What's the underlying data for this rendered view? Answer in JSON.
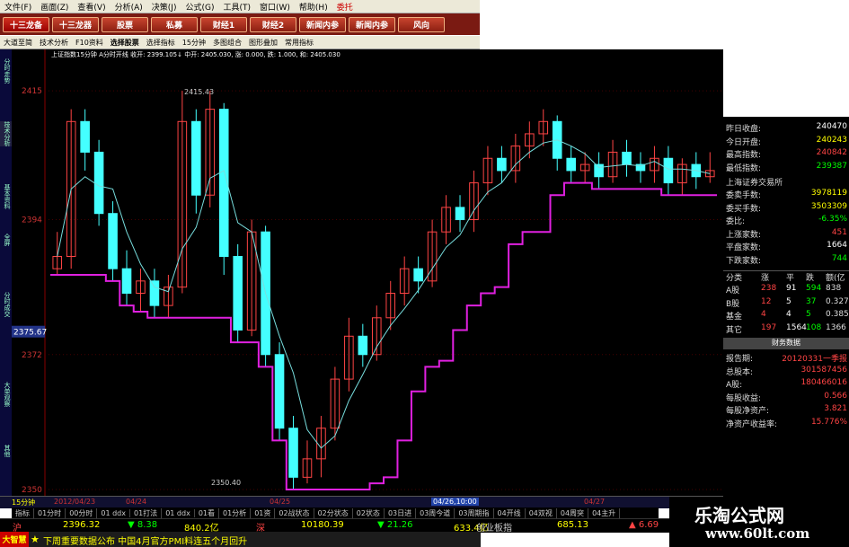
{
  "menu": [
    "文件(F)",
    "画面(Z)",
    "查看(V)",
    "分析(A)",
    "决策(J)",
    "公式(G)",
    "工具(T)",
    "窗口(W)",
    "帮助(H)",
    "委托"
  ],
  "buttons": [
    "十三龙备",
    "十三龙器",
    "股票",
    "私募",
    "财经1",
    "财经2",
    "新闻内参",
    "新闻内参",
    "风向"
  ],
  "toolbar": [
    "大道至简",
    "技术分析",
    "F10资料",
    "选择股票",
    "选择指标",
    "15分钟",
    "多图组合",
    "图形叠加",
    "常用指标"
  ],
  "infobar": "上证指数15分钟  A分时开线  收开: 2399.105↓ 中开: 2405.030, 涨: 0.000, 跌: 1.000, 和: 2405.030",
  "yaxis": {
    "ticks": [
      "2415",
      "2394",
      "2372",
      "2350"
    ],
    "current": "2375.67",
    "high_label": "2415.43",
    "low_label": "2350.40"
  },
  "sidetabs": [
    "分时走势",
    "技术分析",
    "基本资料",
    "全屏",
    "分时成交",
    "大单观察",
    "其他"
  ],
  "right_panel": {
    "rows": [
      {
        "k": "昨日收盘:",
        "v": "240470",
        "c": "#fff"
      },
      {
        "k": "今日开盘:",
        "v": "240243",
        "c": "#ff0"
      },
      {
        "k": "最高指数:",
        "v": "240842",
        "c": "#f44"
      },
      {
        "k": "最低指数:",
        "v": "239387",
        "c": "#0f0"
      }
    ],
    "exchange": "上海证券交易所",
    "rows2": [
      {
        "k": "委卖手数:",
        "v": "3978119",
        "c": "#ff0"
      },
      {
        "k": "委买手数:",
        "v": "3503309",
        "c": "#ff0"
      },
      {
        "k": "委比:",
        "v": "-6.35%",
        "c": "#0f0"
      },
      {
        "k": "上涨家数:",
        "v": "451",
        "c": "#f44"
      },
      {
        "k": "平盘家数:",
        "v": "1664",
        "c": "#fff"
      },
      {
        "k": "下跌家数:",
        "v": "744",
        "c": "#0f0"
      }
    ],
    "table_head": [
      "分类",
      "涨",
      "平",
      "跌",
      "额(亿"
    ],
    "table": [
      [
        "A股",
        "238",
        "91",
        "594",
        "838"
      ],
      [
        "B股",
        "12",
        "5",
        "37",
        "0.327"
      ],
      [
        "基金",
        "4",
        "4",
        "5",
        "0.385"
      ],
      [
        "其它",
        "197",
        "1564",
        "108",
        "1366"
      ]
    ],
    "fin_title": "财务数据",
    "fin": [
      {
        "k": "报告期:",
        "v": "20120331一季报",
        "c": "#f44"
      },
      {
        "k": "总股本:",
        "v": "301587456",
        "c": "#f44"
      },
      {
        "k": "A股:",
        "v": "180466016",
        "c": "#f44"
      },
      {
        "k": "每股收益:",
        "v": "0.566",
        "c": "#f44"
      },
      {
        "k": "每股净资产:",
        "v": "3.821",
        "c": "#f44"
      },
      {
        "k": "净资产收益率:",
        "v": "15.776%",
        "c": "#f44"
      }
    ]
  },
  "bottom_dates": [
    "2012/04/23",
    "04/24",
    "04/25",
    "04/26,10:00",
    "04/27"
  ],
  "time_label": "15分钟",
  "timebar": [
    "指标",
    "01分时",
    "00分时",
    "01 ddx",
    "01打法",
    "01 ddx",
    "01看",
    "01分析",
    "01资",
    "02战状态",
    "02分状态",
    "02状态",
    "03日进",
    "03周今道",
    "03周期指",
    "04开线",
    "04双视",
    "04周突",
    "04主升"
  ],
  "quote": [
    {
      "t": "沪",
      "c": "#f44"
    },
    {
      "t": "2396.32",
      "c": "#ff0"
    },
    {
      "t": "▼ 8.38",
      "c": "#0f0"
    },
    {
      "t": "840.2亿",
      "c": "#ff0"
    },
    {
      "t": "深",
      "c": "#f44"
    },
    {
      "t": "10180.39",
      "c": "#ff0"
    },
    {
      "t": "▼ 21.26",
      "c": "#0f0"
    },
    {
      "t": "633.4亿",
      "c": "#ff0"
    },
    {
      "t": "创业板指",
      "c": "#ccc"
    },
    {
      "t": "685.13",
      "c": "#ff0"
    },
    {
      "t": "▲ 6.69",
      "c": "#f44"
    }
  ],
  "ticker": {
    "label": "大智慧",
    "text": "下周重要数据公布 中国4月官方PMI料连五个月回升"
  },
  "watermark": {
    "line1": "乐淘公式网",
    "line2": "www.60lt.com"
  },
  "chart_data": {
    "type": "candlestick",
    "title": "上证指数15分钟",
    "ylim": [
      2350,
      2420
    ],
    "candles": [
      [
        2386,
        2388,
        2392,
        2385
      ],
      [
        2388,
        2410,
        2412,
        2386
      ],
      [
        2410,
        2405,
        2412,
        2402
      ],
      [
        2405,
        2395,
        2407,
        2393
      ],
      [
        2395,
        2386,
        2397,
        2384
      ],
      [
        2386,
        2382,
        2389,
        2380
      ],
      [
        2382,
        2384,
        2386,
        2379
      ],
      [
        2384,
        2380,
        2386,
        2378
      ],
      [
        2380,
        2383,
        2385,
        2378
      ],
      [
        2383,
        2410,
        2415,
        2382
      ],
      [
        2410,
        2398,
        2412,
        2395
      ],
      [
        2398,
        2412,
        2415,
        2396
      ],
      [
        2412,
        2388,
        2413,
        2385
      ],
      [
        2388,
        2376,
        2390,
        2374
      ],
      [
        2376,
        2392,
        2394,
        2375
      ],
      [
        2392,
        2372,
        2393,
        2370
      ],
      [
        2372,
        2360,
        2374,
        2358
      ],
      [
        2360,
        2352,
        2362,
        2350
      ],
      [
        2352,
        2355,
        2358,
        2351
      ],
      [
        2355,
        2360,
        2362,
        2352
      ],
      [
        2360,
        2368,
        2370,
        2358
      ],
      [
        2368,
        2375,
        2378,
        2366
      ],
      [
        2375,
        2372,
        2377,
        2370
      ],
      [
        2372,
        2378,
        2380,
        2371
      ],
      [
        2378,
        2382,
        2384,
        2376
      ],
      [
        2382,
        2386,
        2388,
        2380
      ],
      [
        2386,
        2384,
        2388,
        2382
      ],
      [
        2384,
        2392,
        2394,
        2383
      ],
      [
        2392,
        2396,
        2398,
        2390
      ],
      [
        2396,
        2394,
        2398,
        2392
      ],
      [
        2394,
        2400,
        2402,
        2392
      ],
      [
        2400,
        2404,
        2406,
        2398
      ],
      [
        2404,
        2402,
        2406,
        2400
      ],
      [
        2402,
        2406,
        2408,
        2400
      ],
      [
        2406,
        2408,
        2410,
        2404
      ],
      [
        2408,
        2410,
        2412,
        2406
      ],
      [
        2410,
        2404,
        2411,
        2402
      ],
      [
        2404,
        2402,
        2406,
        2400
      ],
      [
        2402,
        2403,
        2405,
        2400
      ],
      [
        2403,
        2401,
        2405,
        2399
      ],
      [
        2401,
        2405,
        2407,
        2400
      ],
      [
        2405,
        2403,
        2407,
        2401
      ],
      [
        2403,
        2402,
        2405,
        2400
      ],
      [
        2402,
        2404,
        2406,
        2400
      ],
      [
        2404,
        2400,
        2406,
        2398
      ],
      [
        2400,
        2403,
        2404,
        2398
      ],
      [
        2403,
        2401,
        2405,
        2399
      ],
      [
        2401,
        2402,
        2405,
        2400
      ]
    ]
  }
}
